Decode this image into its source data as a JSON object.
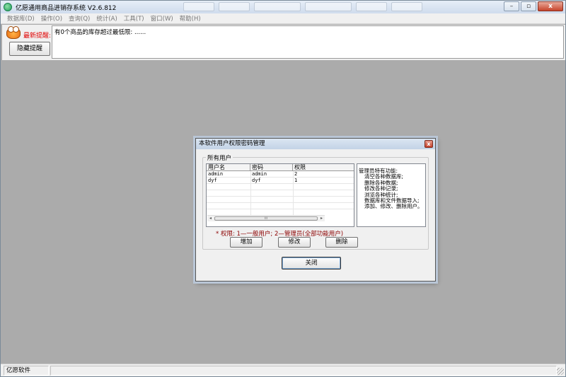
{
  "window": {
    "title": "亿愿通用商品进销存系统 V2.6.812",
    "minimize_glyph": "–",
    "maximize_glyph": "▫",
    "close_glyph": "x"
  },
  "menu": [
    "数据库(D)",
    "操作(O)",
    "查询(Q)",
    "统计(A)",
    "工具(T)",
    "窗口(W)",
    "帮助(H)"
  ],
  "alert": {
    "title": "最新提醒:",
    "hide_button": "隐藏提醒",
    "message": "有0个商品的库存超过最低限: ......"
  },
  "dialog": {
    "title": "本软件用户权限密码管理",
    "close_glyph": "x",
    "group_title": "所有用户",
    "columns": [
      "用户名",
      "密码",
      "权限"
    ],
    "rows": [
      [
        "admin",
        "admin",
        "2"
      ],
      [
        "dyf",
        "dyf",
        "1"
      ]
    ],
    "scroll_left": "◂",
    "scroll_right": "▸",
    "scroll_grip": "III",
    "info_title": "管理员特有功能:",
    "info_lines": [
      "清空各种数据库;",
      "删除各种数据;",
      "修改各种记录;",
      "浏览各种统计;",
      "数据库和文件数据导入;",
      "添加、修改、删除用户。"
    ],
    "permission_note": "* 权限: 1—一般用户;   2—管理员(全部功能用户)",
    "add_button": "增加",
    "edit_button": "修改",
    "delete_button": "删除",
    "close_button": "关闭"
  },
  "status": {
    "company": "亿愿软件"
  }
}
